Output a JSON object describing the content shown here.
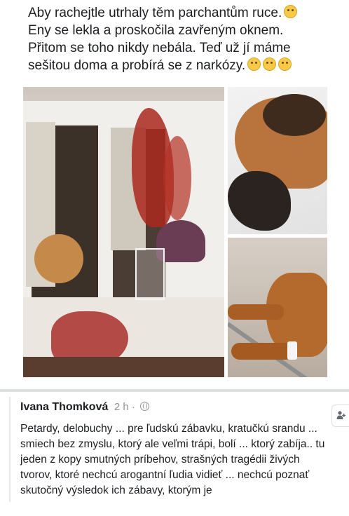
{
  "post": {
    "text_line1": "Aby rachejtle utrhaly těm parchantům ruce.",
    "text_line2": "Eny se lekla a proskočila zavřeným oknem.",
    "text_line3": "Přitom se toho nikdy nebála. Teď už jí máme",
    "text_line4": "sešitou doma a probírá se z narkózy.",
    "emoji_line1": "sad-face-emoji",
    "emoji_line4": [
      "crying-face-emoji",
      "crying-face-emoji",
      "crying-face-emoji"
    ]
  },
  "photos": {
    "main_description_icon": "window-photo",
    "top_right_icon": "dog-head-photo",
    "bottom_right_icon": "dog-body-photo"
  },
  "comment": {
    "author": "Ivana Thomková",
    "time": "2 h ·",
    "privacy_icon": "globe-icon",
    "body": "Petardy, delobuchy ... pre ľudskú zábavku, kratučkú srandu ... smiech bez zmyslu, ktorý ale veľmi trápi, bolí ... ktorý zabíja.. tu jeden z kopy smutných príbehov, strašných tragédii živých tvorov, ktoré nechcú arogantní ľudia vidieť ... nechcú poznať skutočný výsledok ich zábavy, ktorým je"
  },
  "side_button_icon": "add-friend-icon"
}
